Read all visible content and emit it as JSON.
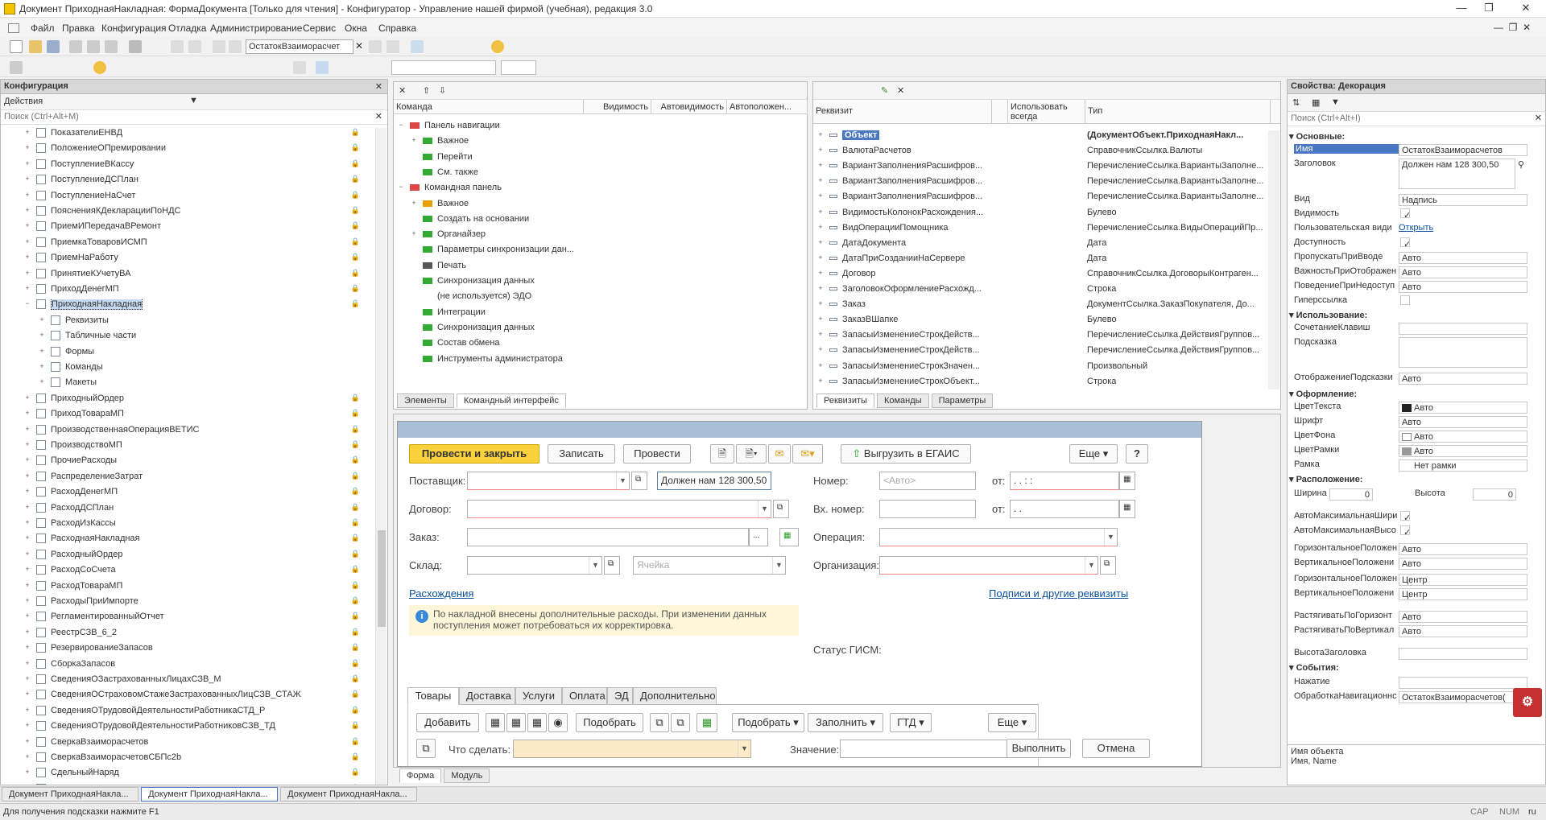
{
  "window": {
    "title": "Документ ПриходнаяНакладная: ФормаДокумента [Только для чтения] - Конфигуратор - Управление нашей фирмой (учебная), редакция 3.0"
  },
  "menu": [
    "Файл",
    "Правка",
    "Конфигурация",
    "Отладка",
    "Администрирование",
    "Сервис",
    "Окна",
    "Справка"
  ],
  "toolbar": {
    "search_value": "ОстатокВзаиморасчет"
  },
  "config_panel": {
    "title": "Конфигурация",
    "actions_label": "Действия",
    "search_placeholder": "Поиск (Ctrl+Alt+M)",
    "items_before": [
      "ПоказателиЕНВД",
      "ПоложениеОПремировании",
      "ПоступлениеВКассу",
      "ПоступлениеДСПлан",
      "ПоступлениеНаСчет",
      "ПоясненияКДекларацииПоНДС",
      "ПриемИПередачаВРемонт",
      "ПриемкаТоваровИСМП",
      "ПриемНаРаботу",
      "ПринятиеКУчетуВА",
      "ПриходДенегМП"
    ],
    "selected": "ПриходнаяНакладная",
    "children": [
      "Реквизиты",
      "Табличные части",
      "Формы",
      "Команды",
      "Макеты"
    ],
    "items_after": [
      "ПриходныйОрдер",
      "ПриходТовараМП",
      "ПроизводственнаяОперацияВЕТИС",
      "ПроизводствоМП",
      "ПрочиеРасходы",
      "РаспределениеЗатрат",
      "РасходДенегМП",
      "РасходДСПлан",
      "РасходИзКассы",
      "РасходнаяНакладная",
      "РасходныйОрдер",
      "РасходСоСчета",
      "РасходТовараМП",
      "РасходыПриИмпорте",
      "РегламентированныйОтчет",
      "РеестрСЗВ_6_2",
      "РезервированиеЗапасов",
      "СборкаЗапасов",
      "СведенияОЗастрахованныхЛицахСЗВ_М",
      "СведенияОСтраховомСтажеЗастрахованныхЛицСЗВ_СТАЖ",
      "СведенияОТрудовойДеятельностиРаботникаСТД_Р",
      "СведенияОТрудовойДеятельностиРаботниковСЗВ_ТД",
      "СверкаВзаиморасчетов",
      "СверкаВзаиморасчетовСБПс2b",
      "СдельныйНаряд",
      "Событие"
    ]
  },
  "cmd_panel": {
    "headers": [
      "Команда",
      "Видимость",
      "Автовидимость",
      "Автоположен..."
    ],
    "rows": [
      "Панель навигации",
      "Важное",
      "Перейти",
      "См. также",
      "Командная панель",
      "Важное",
      "Создать на основании",
      "Органайзер",
      "Параметры синхронизации дан...",
      "Печать",
      "Синхронизация данных",
      "(не используется) ЭДО",
      "Интеграции",
      "Синхронизация данных",
      "Состав обмена",
      "Инструменты администратора"
    ],
    "tabs": [
      "Элементы",
      "Командный интерфейс"
    ]
  },
  "req_panel": {
    "headers": [
      "Реквизит",
      "Использовать всегда",
      "Тип"
    ],
    "rows": [
      {
        "n": "Объект",
        "t": "(ДокументОбъект.ПриходнаяНакл..."
      },
      {
        "n": "ВалютаРасчетов",
        "t": "СправочникСсылка.Валюты"
      },
      {
        "n": "ВариантЗаполненияРасшифров...",
        "t": "ПеречислениеСсылка.ВариантыЗаполне..."
      },
      {
        "n": "ВариантЗаполненияРасшифров...",
        "t": "ПеречислениеСсылка.ВариантыЗаполне..."
      },
      {
        "n": "ВариантЗаполненияРасшифров...",
        "t": "ПеречислениеСсылка.ВариантыЗаполне..."
      },
      {
        "n": "ВидимостьКолонокРасхождения...",
        "t": "Булево"
      },
      {
        "n": "ВидОперацииПомощника",
        "t": "ПеречислениеСсылка.ВидыОперацийПр..."
      },
      {
        "n": "ДатаДокумента",
        "t": "Дата"
      },
      {
        "n": "ДатаПриСозданииНаСервере",
        "t": "Дата"
      },
      {
        "n": "Договор",
        "t": "СправочникСсылка.ДоговорыКонтраген..."
      },
      {
        "n": "ЗаголовокОформлениеРасхожд...",
        "t": "Строка"
      },
      {
        "n": "Заказ",
        "t": "ДокументСсылка.ЗаказПокупателя, До..."
      },
      {
        "n": "ЗаказВШапке",
        "t": "Булево"
      },
      {
        "n": "ЗапасыИзменениеСтрокДейств...",
        "t": "ПеречислениеСсылка.ДействияГруппов..."
      },
      {
        "n": "ЗапасыИзменениеСтрокДейств...",
        "t": "ПеречислениеСсылка.ДействияГруппов..."
      },
      {
        "n": "ЗапасыИзменениеСтрокЗначен...",
        "t": "Произвольный"
      },
      {
        "n": "ЗапасыИзменениеСтрокОбъект...",
        "t": "Строка"
      }
    ],
    "tabs": [
      "Реквизиты",
      "Команды",
      "Параметры"
    ]
  },
  "form": {
    "btn_post_close": "Провести и закрыть",
    "btn_save": "Записать",
    "btn_post": "Провести",
    "btn_egais": "Выгрузить в ЕГАИС",
    "btn_more": "Еще",
    "btn_help": "?",
    "lbl_supplier": "Поставщик:",
    "lbl_contract": "Договор:",
    "lbl_order": "Заказ:",
    "lbl_warehouse": "Склад:",
    "debt_text": "Должен нам 128 300,50",
    "lbl_number": "Номер:",
    "number_placeholder": "<Авто>",
    "lbl_from": "от:",
    "lbl_from2": "от:",
    "date_mask": " .  .       :  :  ",
    "date_mask2": " .  .",
    "lbl_innum": "Вх. номер:",
    "lbl_operation": "Операция:",
    "lbl_org": "Организация:",
    "cell_placeholder": "Ячейка",
    "link_diff": "Расхождения",
    "link_sign": "Подписи и другие реквизиты",
    "info": "По накладной внесены дополнительные расходы. При изменении данных поступления может потребоваться их корректировка.",
    "status_gism": "Статус ГИСМ:",
    "tabs": [
      "Товары",
      "Доставка",
      "Услуги",
      "Оплата",
      "ЭД",
      "Дополнительно"
    ],
    "btn_add": "Добавить",
    "btn_pick": "Подобрать",
    "btn_pick2": "Подобрать",
    "btn_fill": "Заполнить",
    "btn_gtd": "ГТД",
    "btn_more2": "Еще",
    "lbl_what": "Что сделать:",
    "lbl_value": "Значение:",
    "btn_exec": "Выполнить",
    "btn_cancel": "Отмена"
  },
  "form_tabs": [
    "Форма",
    "Модуль"
  ],
  "props": {
    "title": "Свойства: Декорация",
    "search_placeholder": "Поиск (Ctrl+Alt+I)",
    "sec_main": "Основные:",
    "name_k": "Имя",
    "name_v": "ОстатокВзаиморасчетов",
    "title_k": "Заголовок",
    "title_v": "Должен нам 128 300,50",
    "kind_k": "Вид",
    "kind_v": "Надпись",
    "vis_k": "Видимость",
    "uservis_k": "Пользовательская види",
    "uservis_v": "Открыть",
    "avail_k": "Доступность",
    "skip_k": "ПропускатьПриВводе",
    "skip_v": "Авто",
    "imp_k": "ВажностьПриОтображен",
    "imp_v": "Авто",
    "beh_k": "ПоведениеПриНедоступ",
    "beh_v": "Авто",
    "hyper_k": "Гиперссылка",
    "sec_use": "Использование:",
    "key_k": "СочетаниеКлавиш",
    "hint_k": "Подсказка",
    "hintdisp_k": "ОтображениеПодсказки",
    "hintdisp_v": "Авто",
    "sec_design": "Оформление:",
    "tcolor_k": "ЦветТекста",
    "tcolor_v": "Авто",
    "font_k": "Шрифт",
    "font_v": "Авто",
    "bg_k": "ЦветФона",
    "bg_v": "Авто",
    "bc_k": "ЦветРамки",
    "bc_v": "Авто",
    "frame_k": "Рамка",
    "frame_v": "Нет рамки",
    "sec_pos": "Расположение:",
    "w_k": "Ширина",
    "w_v": "0",
    "h_k": "Высота",
    "h_v": "0",
    "amw_k": "АвтоМаксимальнаяШири",
    "amh_k": "АвтоМаксимальнаяВысо",
    "hp_k": "ГоризонтальноеПоложен",
    "hp_v": "Авто",
    "vp_k": "ВертикальноеПоложени",
    "vp_v": "Авто",
    "hp2_k": "ГоризонтальноеПоложен",
    "hp2_v": "Центр",
    "vp2_k": "ВертикальноеПоложени",
    "vp2_v": "Центр",
    "sh_k": "РастягиватьПоГоризонт",
    "sh_v": "Авто",
    "sv_k": "РастягиватьПоВертикал",
    "sv_v": "Авто",
    "th_k": "ВысотаЗаголовка",
    "sec_events": "События:",
    "press_k": "Нажатие",
    "nav_k": "ОбработкаНавигационнс",
    "nav_v": "ОстатокВзаиморасчетов(",
    "desc1": "Имя объекта",
    "desc2": "Имя, Name"
  },
  "taskbar": [
    "Документ ПриходнаяНакла...",
    "Документ ПриходнаяНакла...",
    "Документ ПриходнаяНакла..."
  ],
  "status": {
    "hint": "Для получения подсказки нажмите F1",
    "cap": "CAP",
    "num": "NUM",
    "lang": "ru"
  }
}
